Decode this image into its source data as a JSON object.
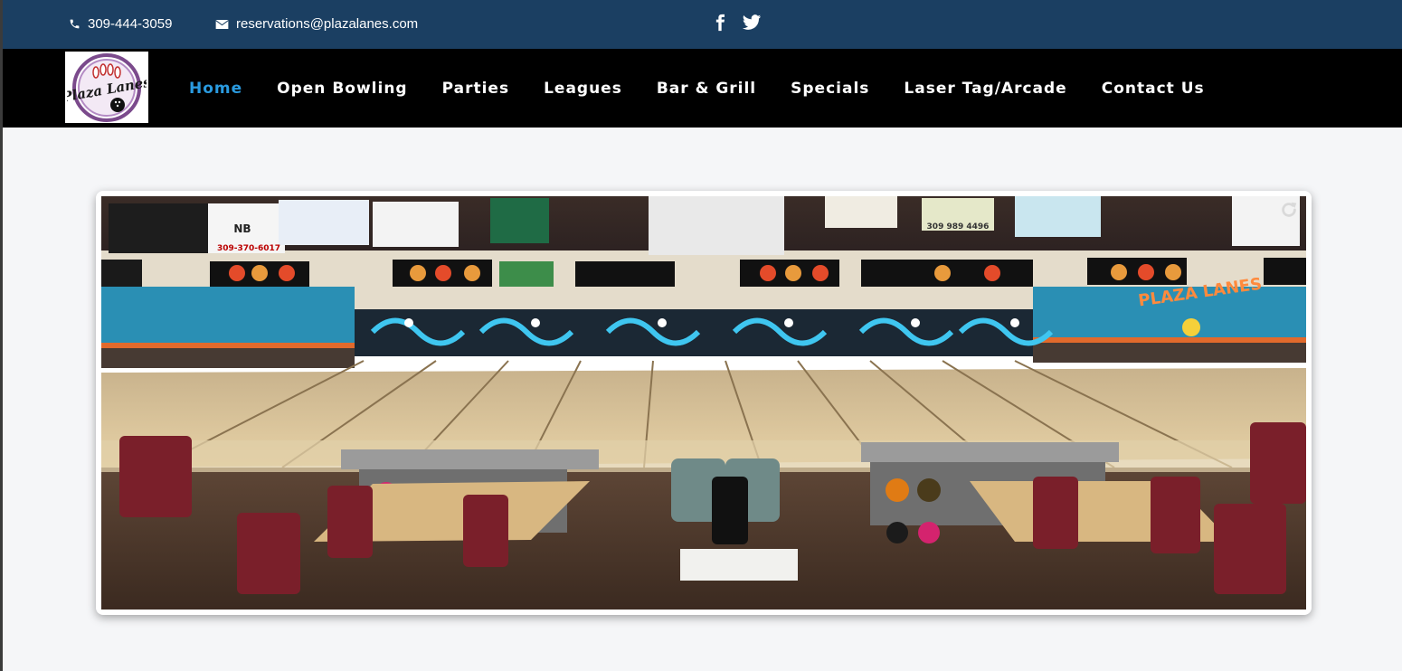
{
  "topbar": {
    "phone": "309-444-3059",
    "email": "reservations@plazalanes.com",
    "phone_icon": "phone-icon",
    "email_icon": "envelope-icon",
    "social": [
      "facebook-icon",
      "twitter-icon"
    ]
  },
  "nav": {
    "logo_text": "Plaza Lanes",
    "items": [
      {
        "label": "Home",
        "active": true
      },
      {
        "label": "Open Bowling"
      },
      {
        "label": "Parties"
      },
      {
        "label": "Leagues"
      },
      {
        "label": "Bar & Grill"
      },
      {
        "label": "Specials"
      },
      {
        "label": "Laser Tag/Arcade"
      },
      {
        "label": "Contact Us"
      }
    ]
  },
  "hero": {
    "signs": [
      "NB",
      "309-370-6017",
      "309 989 4496",
      "PLAZA LANES"
    ],
    "reload_icon": "reload-icon"
  },
  "colors": {
    "topbar": "#1b3f62",
    "navbar": "#000000",
    "active": "#2a9be0",
    "page_bg": "#f5f6f8"
  }
}
